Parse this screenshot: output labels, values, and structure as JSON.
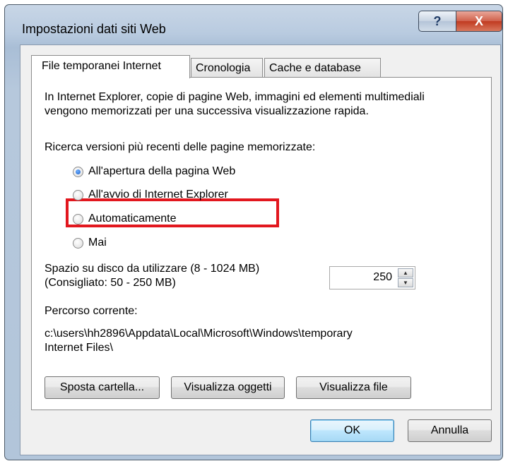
{
  "window": {
    "title": "Impostazioni dati siti Web",
    "help_label": "?",
    "close_label": "X"
  },
  "tabs": [
    {
      "label": "File temporanei Internet",
      "active": true
    },
    {
      "label": "Cronologia",
      "active": false
    },
    {
      "label": "Cache e database",
      "active": false
    }
  ],
  "panel": {
    "description_line1": "In Internet Explorer, copie di pagine Web, immagini ed elementi multimediali",
    "description_line2": "vengono memorizzati per una successiva visualizzazione rapida.",
    "check_heading": "Ricerca versioni più recenti delle pagine memorizzate:",
    "options": [
      {
        "label": "All'apertura della pagina Web",
        "checked": true
      },
      {
        "label": "All'avvio di Internet Explorer",
        "checked": false
      },
      {
        "label": "Automaticamente",
        "checked": false
      },
      {
        "label": "Mai",
        "checked": false
      }
    ],
    "disk_label_line1": "Spazio su disco da utilizzare (8 - 1024 MB)",
    "disk_label_line2": "(Consigliato: 50 - 250 MB)",
    "disk_value": "250",
    "path_heading": "Percorso corrente:",
    "path_line1": "c:\\users\\hh2896\\Appdata\\Local\\Microsoft\\Windows\\temporary",
    "path_line2": "Internet Files\\",
    "buttons": {
      "move_folder": "Sposta cartella...",
      "view_objects": "Visualizza oggetti",
      "view_files": "Visualizza file"
    }
  },
  "footer": {
    "ok": "OK",
    "cancel": "Annulla"
  },
  "colors": {
    "highlight": "#e2171e",
    "close_button": "#c03a20"
  }
}
